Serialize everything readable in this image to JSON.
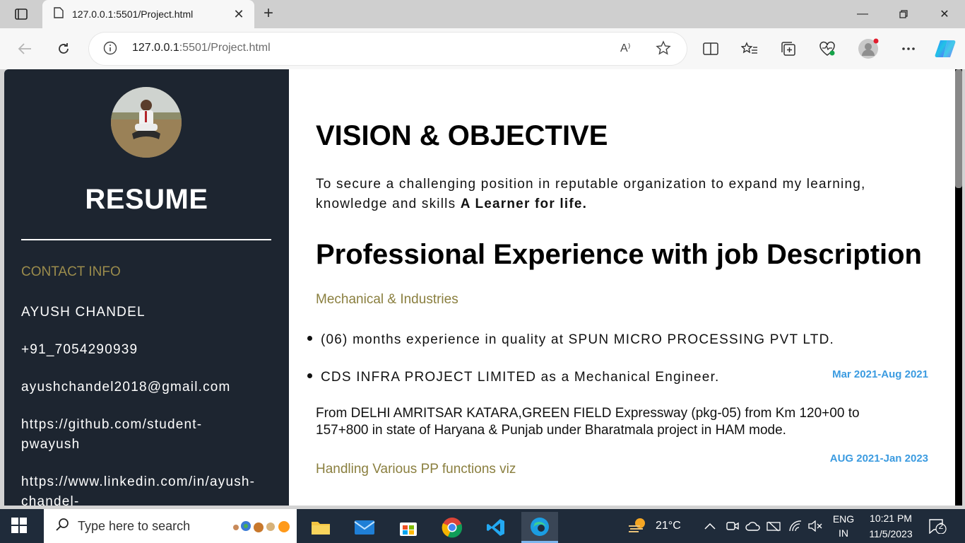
{
  "browser": {
    "tab_title": "127.0.0.1:5501/Project.html",
    "url_host": "127.0.0.1",
    "url_rest": ":5501/Project.html",
    "read_aloud_label": "A⁾"
  },
  "sidebar": {
    "resume_title": "RESUME",
    "contact_heading": "CONTACT INFO",
    "contacts": [
      "AYUSH CHANDEL",
      "+91_7054290939",
      "ayushchandel2018@gmail.com",
      "https://github.com/student-pwayush",
      "https://www.linkedin.com/in/ayush-chandel-"
    ]
  },
  "main": {
    "vision_heading": "VISION & OBJECTIVE",
    "vision_text": "To secure a challenging position in reputable organization to expand my learning, knowledge and skills ",
    "vision_bold": "A Learner for life.",
    "experience_heading": "Professional Experience with job Description",
    "industry": "Mechanical & Industries",
    "bullets": [
      "(06) months experience in quality at SPUN MICRO PROCESSING PVT LTD.",
      "CDS INFRA PROJECT LIMITED as a Mechanical Engineer."
    ],
    "date_1": "Mar 2021-Aug 2021",
    "project_text": "From DELHI AMRITSAR KATARA,GREEN FIELD Expressway (pkg-05) from Km 120+00 to 157+800 in state of Haryana & Punjab under Bharatmala project in HAM mode.",
    "date_2": "AUG 2021-Jan 2023",
    "functions_heading": "Handling Various PP functions viz"
  },
  "taskbar": {
    "search_placeholder": "Type here to search",
    "temperature": "21°C",
    "lang_top": "ENG",
    "lang_bottom": "IN",
    "time": "10:21 PM",
    "date": "11/5/2023",
    "notifications": "2"
  },
  "colors": {
    "sidebar_bg": "#1d2530",
    "accent_olive": "#8a7f3f",
    "date_blue": "#3b9be0",
    "taskbar_bg": "#1f2b3a"
  }
}
